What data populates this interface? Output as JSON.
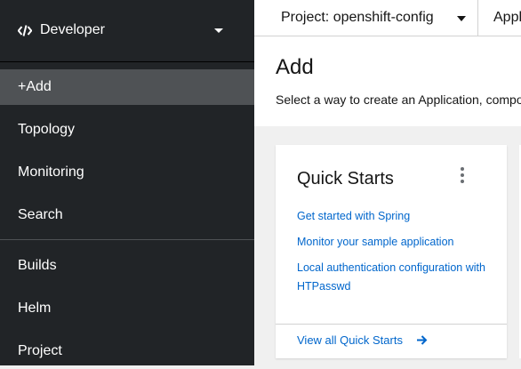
{
  "sidebar": {
    "perspective_label": "Developer",
    "items": [
      {
        "label": "+Add",
        "active": true
      },
      {
        "label": "Topology"
      },
      {
        "label": "Monitoring"
      },
      {
        "label": "Search"
      },
      {
        "label": "Builds"
      },
      {
        "label": "Helm"
      },
      {
        "label": "Project"
      }
    ]
  },
  "masthead": {
    "project_label": "Project: openshift-config",
    "application_label": "Appl"
  },
  "page": {
    "title": "Add",
    "description": "Select a way to create an Application, compo"
  },
  "quick_starts": {
    "title": "Quick Starts",
    "links": [
      "Get started with Spring",
      "Monitor your sample application",
      "Local authentication configuration with HTPasswd"
    ],
    "view_all": "View all Quick Starts"
  },
  "colors": {
    "sidebar_bg": "#212427",
    "active_item_bg": "#4f5255",
    "link": "#0066cc"
  }
}
